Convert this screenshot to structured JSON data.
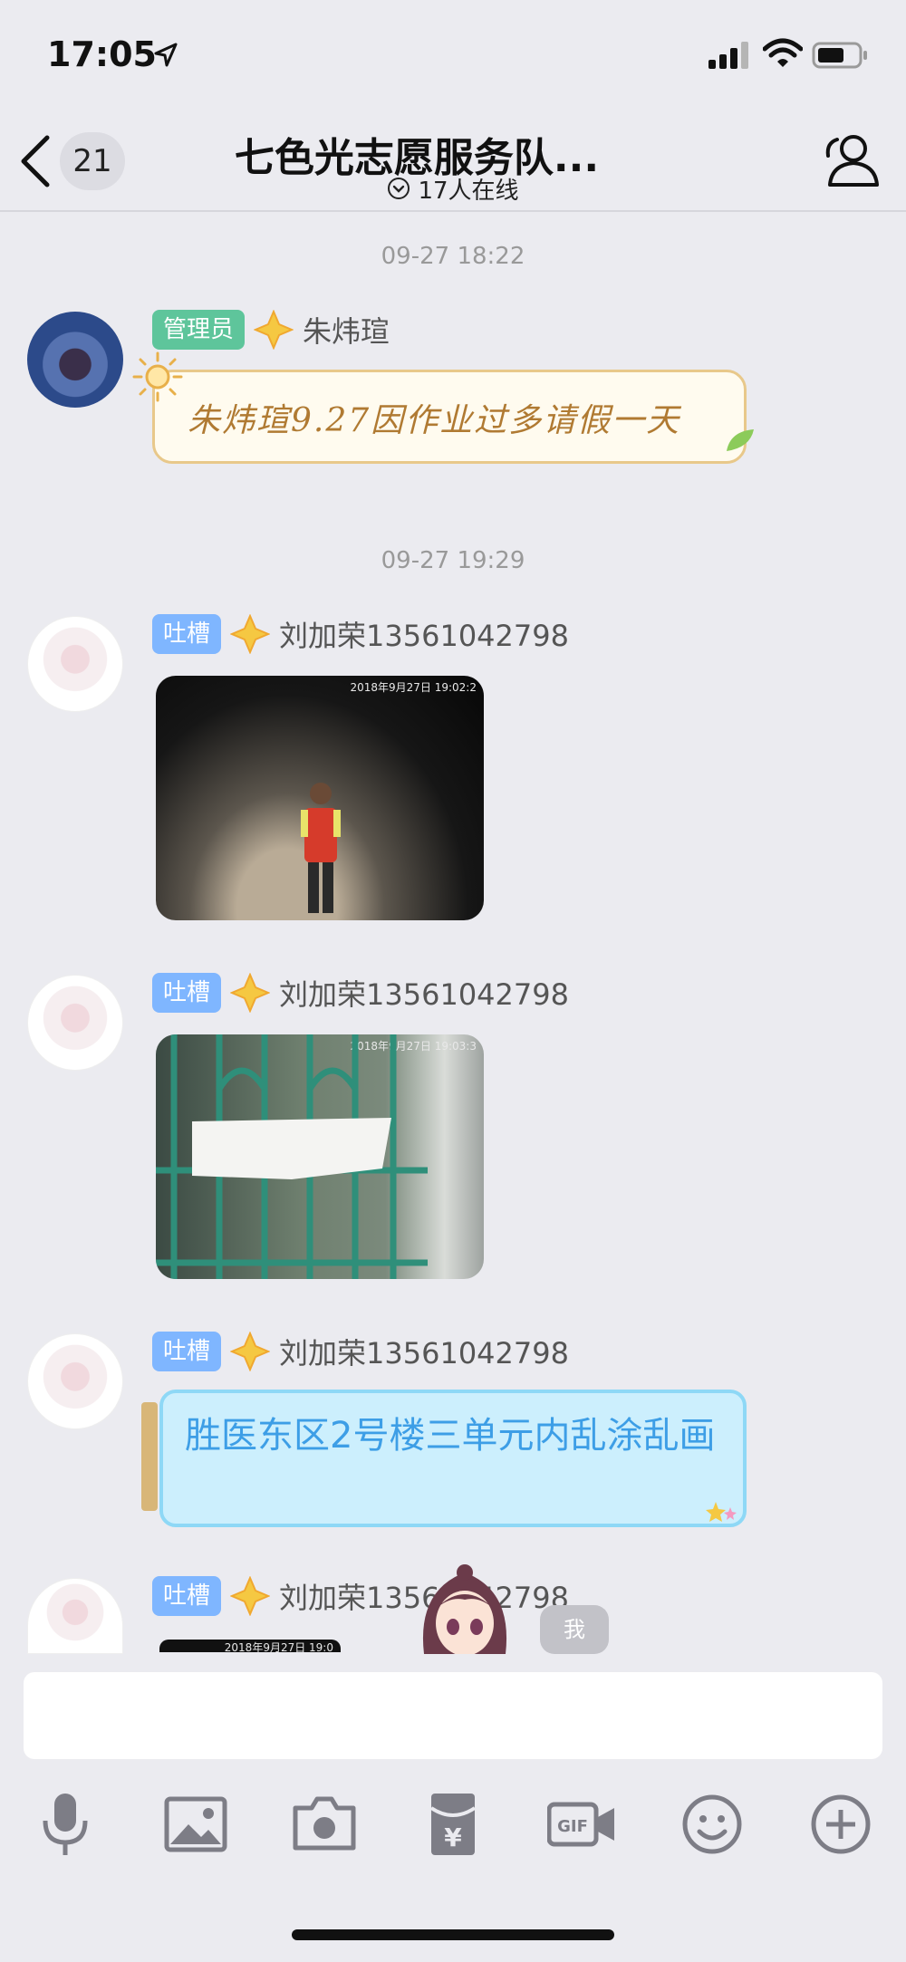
{
  "status_bar": {
    "time": "17:05"
  },
  "nav": {
    "unread_count": "21",
    "title": "七色光志愿服务队...",
    "online": "17人在线"
  },
  "messages": [
    {
      "timestamp": "09-27 18:22",
      "role": "管理员",
      "sender": "朱炜瑄",
      "type": "note",
      "text": "朱炜瑄9.27因作业过多请假一天"
    },
    {
      "timestamp": "09-27 19:29",
      "role": "吐槽",
      "sender": "刘加荣13561042798",
      "type": "image",
      "image_stamp": "2018年9月27日 19:02:2"
    },
    {
      "role": "吐槽",
      "sender": "刘加荣13561042798",
      "type": "image",
      "image_stamp": "2018年9月27日 19:03:3"
    },
    {
      "role": "吐槽",
      "sender": "刘加荣13561042798",
      "type": "text",
      "text": "胜医东区2号楼三单元内乱涂乱画"
    },
    {
      "role": "吐槽",
      "sender": "刘加荣13561042798",
      "type": "image",
      "image_stamp": "2018年9月27日 19:0"
    }
  ],
  "floating": {
    "me_label": "我"
  },
  "input": {
    "placeholder": ""
  },
  "toolbar": [
    "microphone-icon",
    "image-icon",
    "camera-icon",
    "red-packet-icon",
    "gif-icon",
    "emoji-icon",
    "plus-icon"
  ],
  "colors": {
    "background": "#ebebf0",
    "admin_tag": "#5ec59b",
    "tucao_tag": "#7fb6ff",
    "blue_bubble": "#cceffd",
    "blue_text": "#3d9ee6"
  }
}
